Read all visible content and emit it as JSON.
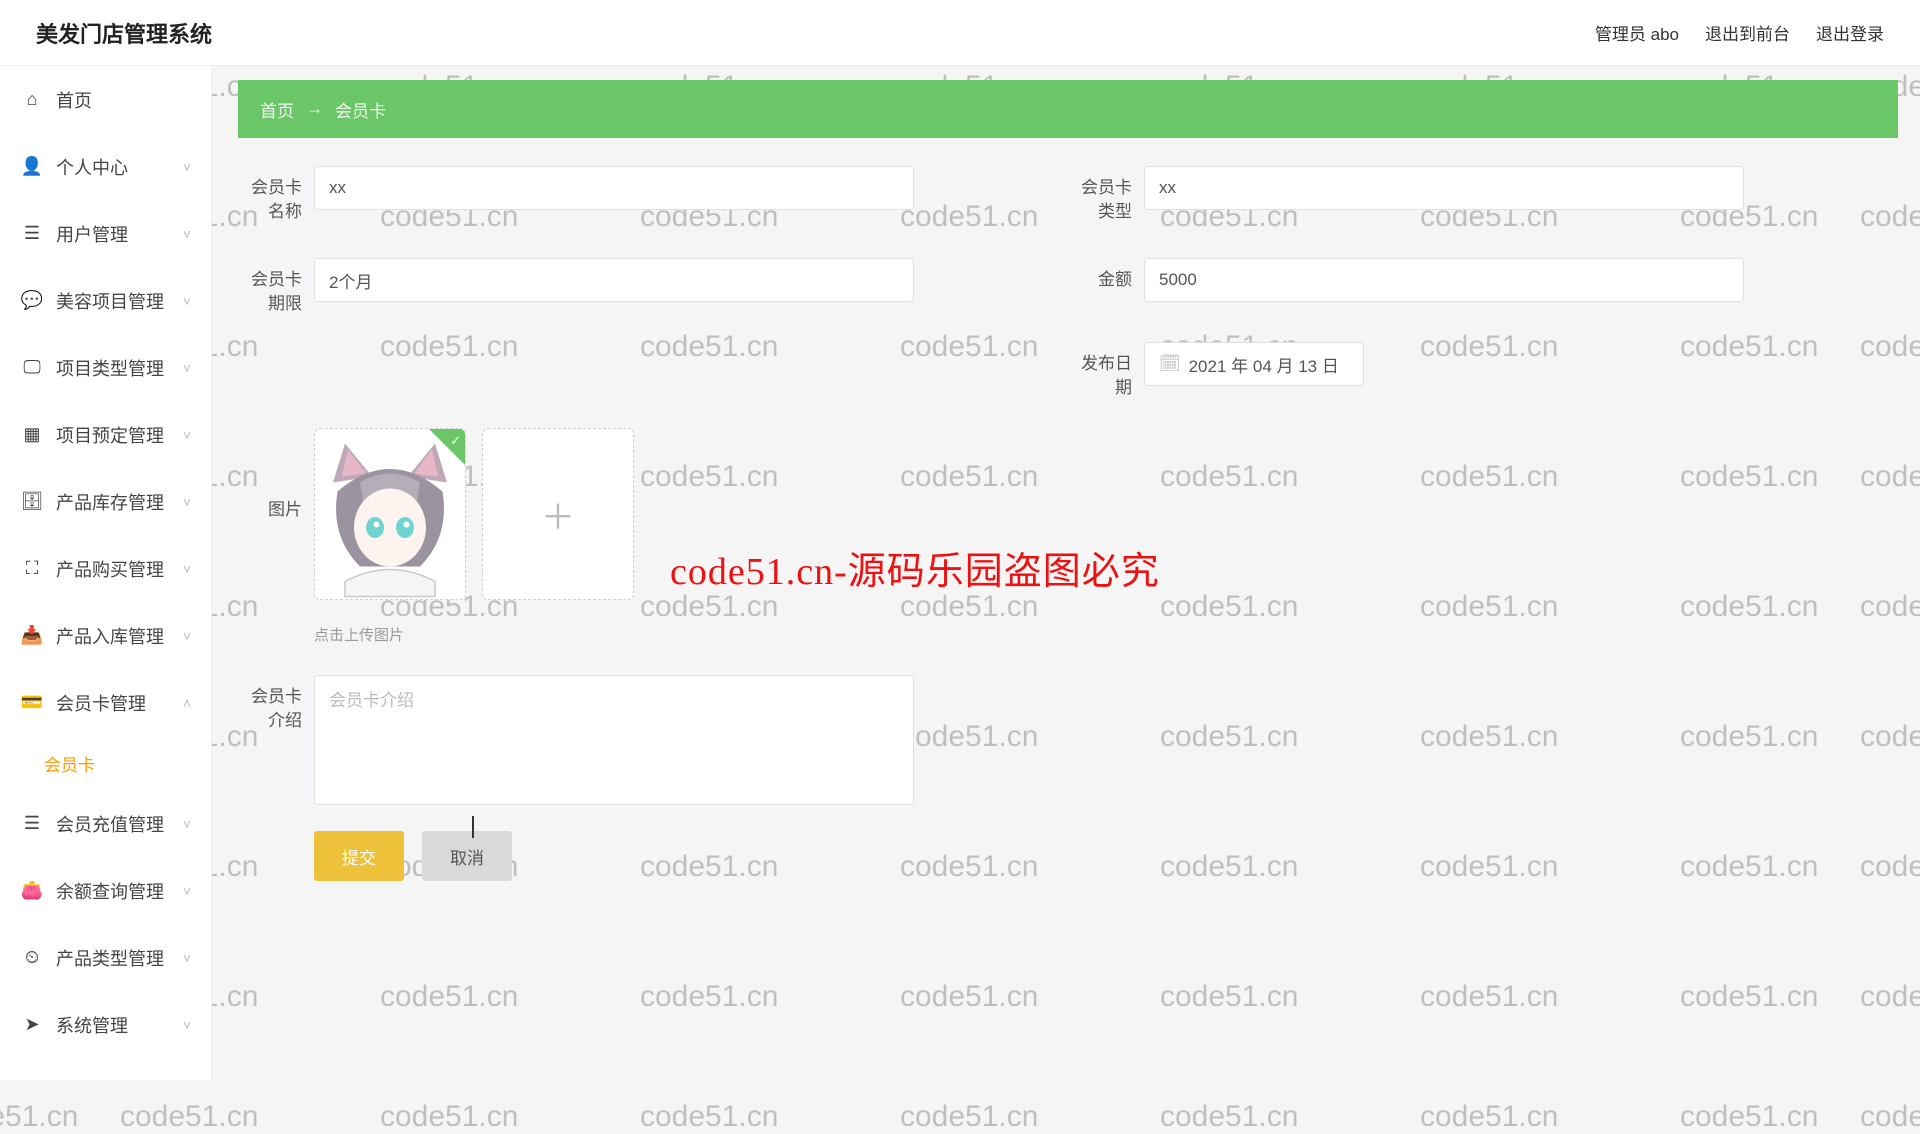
{
  "header": {
    "title": "美发门店管理系统",
    "admin_label": "管理员 abo",
    "exit_front_label": "退出到前台",
    "logout_label": "退出登录"
  },
  "sidebar": {
    "items": [
      {
        "icon": "home-icon",
        "label": "首页",
        "expandable": false
      },
      {
        "icon": "person-icon",
        "label": "个人中心",
        "expandable": true
      },
      {
        "icon": "list-icon",
        "label": "用户管理",
        "expandable": true
      },
      {
        "icon": "chat-icon",
        "label": "美容项目管理",
        "expandable": true
      },
      {
        "icon": "monitor-icon",
        "label": "项目类型管理",
        "expandable": true
      },
      {
        "icon": "grid-icon",
        "label": "项目预定管理",
        "expandable": true
      },
      {
        "icon": "stack-icon",
        "label": "产品库存管理",
        "expandable": true
      },
      {
        "icon": "crop-icon",
        "label": "产品购买管理",
        "expandable": true
      },
      {
        "icon": "inbox-icon",
        "label": "产品入库管理",
        "expandable": true
      },
      {
        "icon": "card-icon",
        "label": "会员卡管理",
        "expandable": true,
        "expanded": true,
        "sub": [
          {
            "label": "会员卡"
          }
        ]
      },
      {
        "icon": "list-icon",
        "label": "会员充值管理",
        "expandable": true
      },
      {
        "icon": "wallet-icon",
        "label": "余额查询管理",
        "expandable": true
      },
      {
        "icon": "clock-icon",
        "label": "产品类型管理",
        "expandable": true
      },
      {
        "icon": "send-icon",
        "label": "系统管理",
        "expandable": true
      }
    ]
  },
  "breadcrumb": {
    "home": "首页",
    "arrow": "→",
    "current": "会员卡"
  },
  "form": {
    "card_name_label": "会员卡名称",
    "card_name_value": "xx",
    "card_type_label": "会员卡类型",
    "card_type_value": "xx",
    "card_term_label": "会员卡期限",
    "card_term_value": "2个月",
    "amount_label": "金额",
    "amount_value": "5000",
    "publish_date_label": "发布日期",
    "publish_date_value": "2021 年 04 月 13 日",
    "image_label": "图片",
    "upload_hint": "点击上传图片",
    "intro_label": "会员卡介绍",
    "intro_placeholder": "会员卡介绍",
    "submit_label": "提交",
    "cancel_label": "取消"
  },
  "watermark_text": "code51.cn",
  "red_banner": "code51.cn-源码乐园盗图必究"
}
